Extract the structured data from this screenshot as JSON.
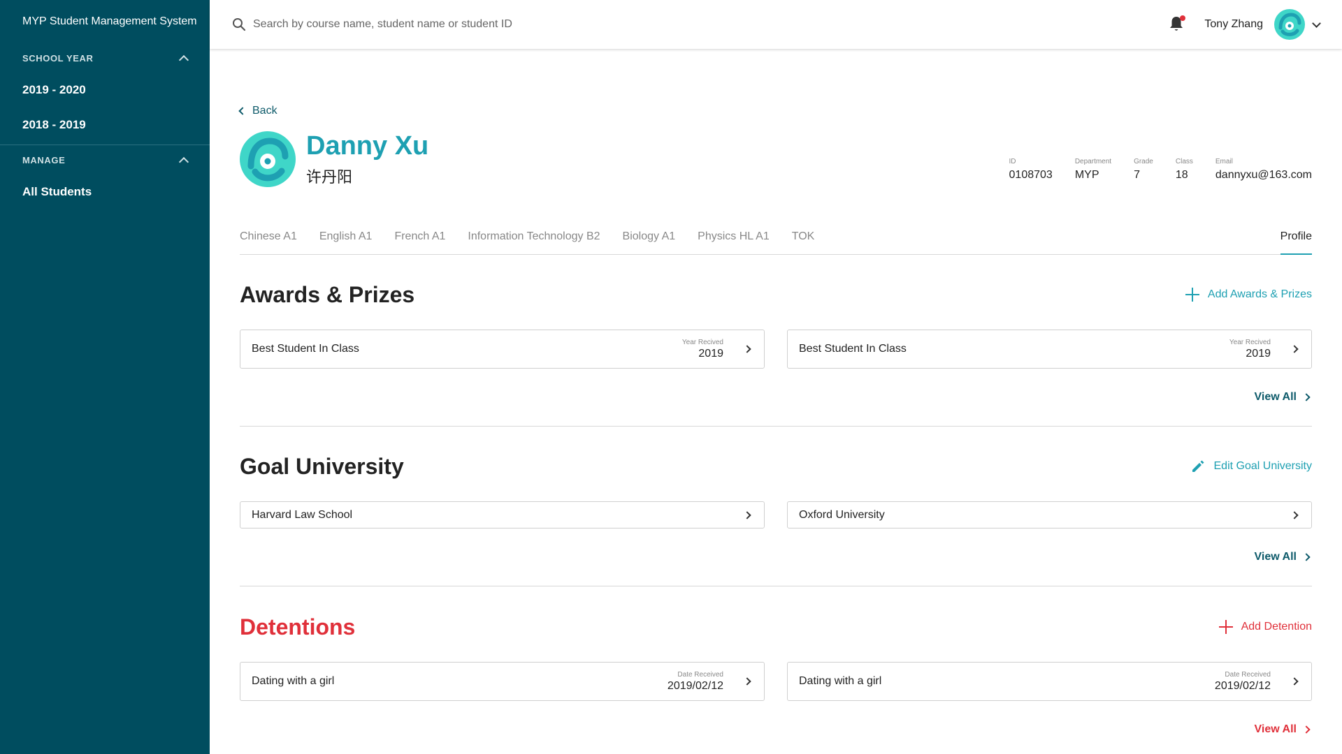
{
  "app": {
    "title": "MYP Student Management System"
  },
  "sidebar": {
    "school_year": {
      "heading": "SCHOOL YEAR",
      "items": [
        {
          "label": "2019 - 2020"
        },
        {
          "label": "2018 - 2019"
        }
      ]
    },
    "manage": {
      "heading": "MANAGE",
      "items": [
        {
          "label": "All Students"
        }
      ]
    }
  },
  "topbar": {
    "search_placeholder": "Search by course name, student name or student ID",
    "user_name": "Tony Zhang"
  },
  "student": {
    "back_label": "Back",
    "name_en": "Danny Xu",
    "name_zh": "许丹阳",
    "info": [
      {
        "label": "ID",
        "value": "0108703"
      },
      {
        "label": "Department",
        "value": "MYP"
      },
      {
        "label": "Grade",
        "value": "7"
      },
      {
        "label": "Class",
        "value": "18"
      },
      {
        "label": "Email",
        "value": "dannyxu@163.com"
      }
    ]
  },
  "tabs": [
    {
      "label": "Chinese A1"
    },
    {
      "label": "English A1"
    },
    {
      "label": "French A1"
    },
    {
      "label": "Information Technology B2"
    },
    {
      "label": "Biology A1"
    },
    {
      "label": "Physics HL A1"
    },
    {
      "label": "TOK"
    },
    {
      "label": "Profile",
      "active": true
    }
  ],
  "awards": {
    "title": "Awards & Prizes",
    "action": "Add Awards & Prizes",
    "items": [
      {
        "label": "Best Student In Class",
        "meta_label": "Year Recived",
        "meta_value": "2019"
      },
      {
        "label": "Best Student In Class",
        "meta_label": "Year Recived",
        "meta_value": "2019"
      }
    ],
    "view_all": "View All"
  },
  "goal": {
    "title": "Goal University",
    "action": "Edit Goal University",
    "items": [
      {
        "label": "Harvard Law School"
      },
      {
        "label": "Oxford University"
      }
    ],
    "view_all": "View All"
  },
  "detentions": {
    "title": "Detentions",
    "action": "Add Detention",
    "items": [
      {
        "label": "Dating with a girl",
        "meta_label": "Date Received",
        "meta_value": "2019/02/12"
      },
      {
        "label": "Dating with a girl",
        "meta_label": "Date Received",
        "meta_value": "2019/02/12"
      }
    ],
    "view_all": "View All"
  },
  "colors": {
    "sidebar": "#004d5f",
    "accent": "#1ea0b2",
    "danger": "#e0303a",
    "link": "#0d5a6a"
  },
  "icons": [
    "search-icon",
    "bell-icon",
    "avatar",
    "chevron-up-icon",
    "chevron-down-icon",
    "chevron-left-icon",
    "chevron-right-icon",
    "plus-icon",
    "pencil-icon"
  ]
}
